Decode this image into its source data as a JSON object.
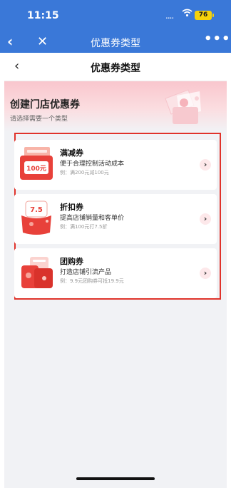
{
  "status_bar": {
    "time": "11:15",
    "signal": "....",
    "battery": "76"
  },
  "nav_bar": {
    "back_icon": "‹",
    "close_icon": "✕",
    "title": "优惠券类型",
    "more_icon": "•••"
  },
  "sub_nav": {
    "back_icon": "‹",
    "title": "优惠券类型"
  },
  "hero": {
    "title": "创建门店优惠券",
    "subtitle": "请选择需要一个类型"
  },
  "coupons": [
    {
      "name": "满减券",
      "desc": "便于合理控制活动成本",
      "example": "例：满200元减100元",
      "badge": "100元",
      "arrow": "›"
    },
    {
      "name": "折扣券",
      "desc": "提高店铺销量和客单价",
      "example": "例：满100元打7.5折",
      "badge": "7.5",
      "arrow": "›"
    },
    {
      "name": "团购券",
      "desc": "打造店铺引流产品",
      "example": "例：9.9元团购券可抵19.9元",
      "badge": "",
      "arrow": "›"
    }
  ],
  "colors": {
    "brand_blue": "#3a78d8",
    "highlight_red": "#e0332b",
    "coupon_red": "#e8413a"
  }
}
